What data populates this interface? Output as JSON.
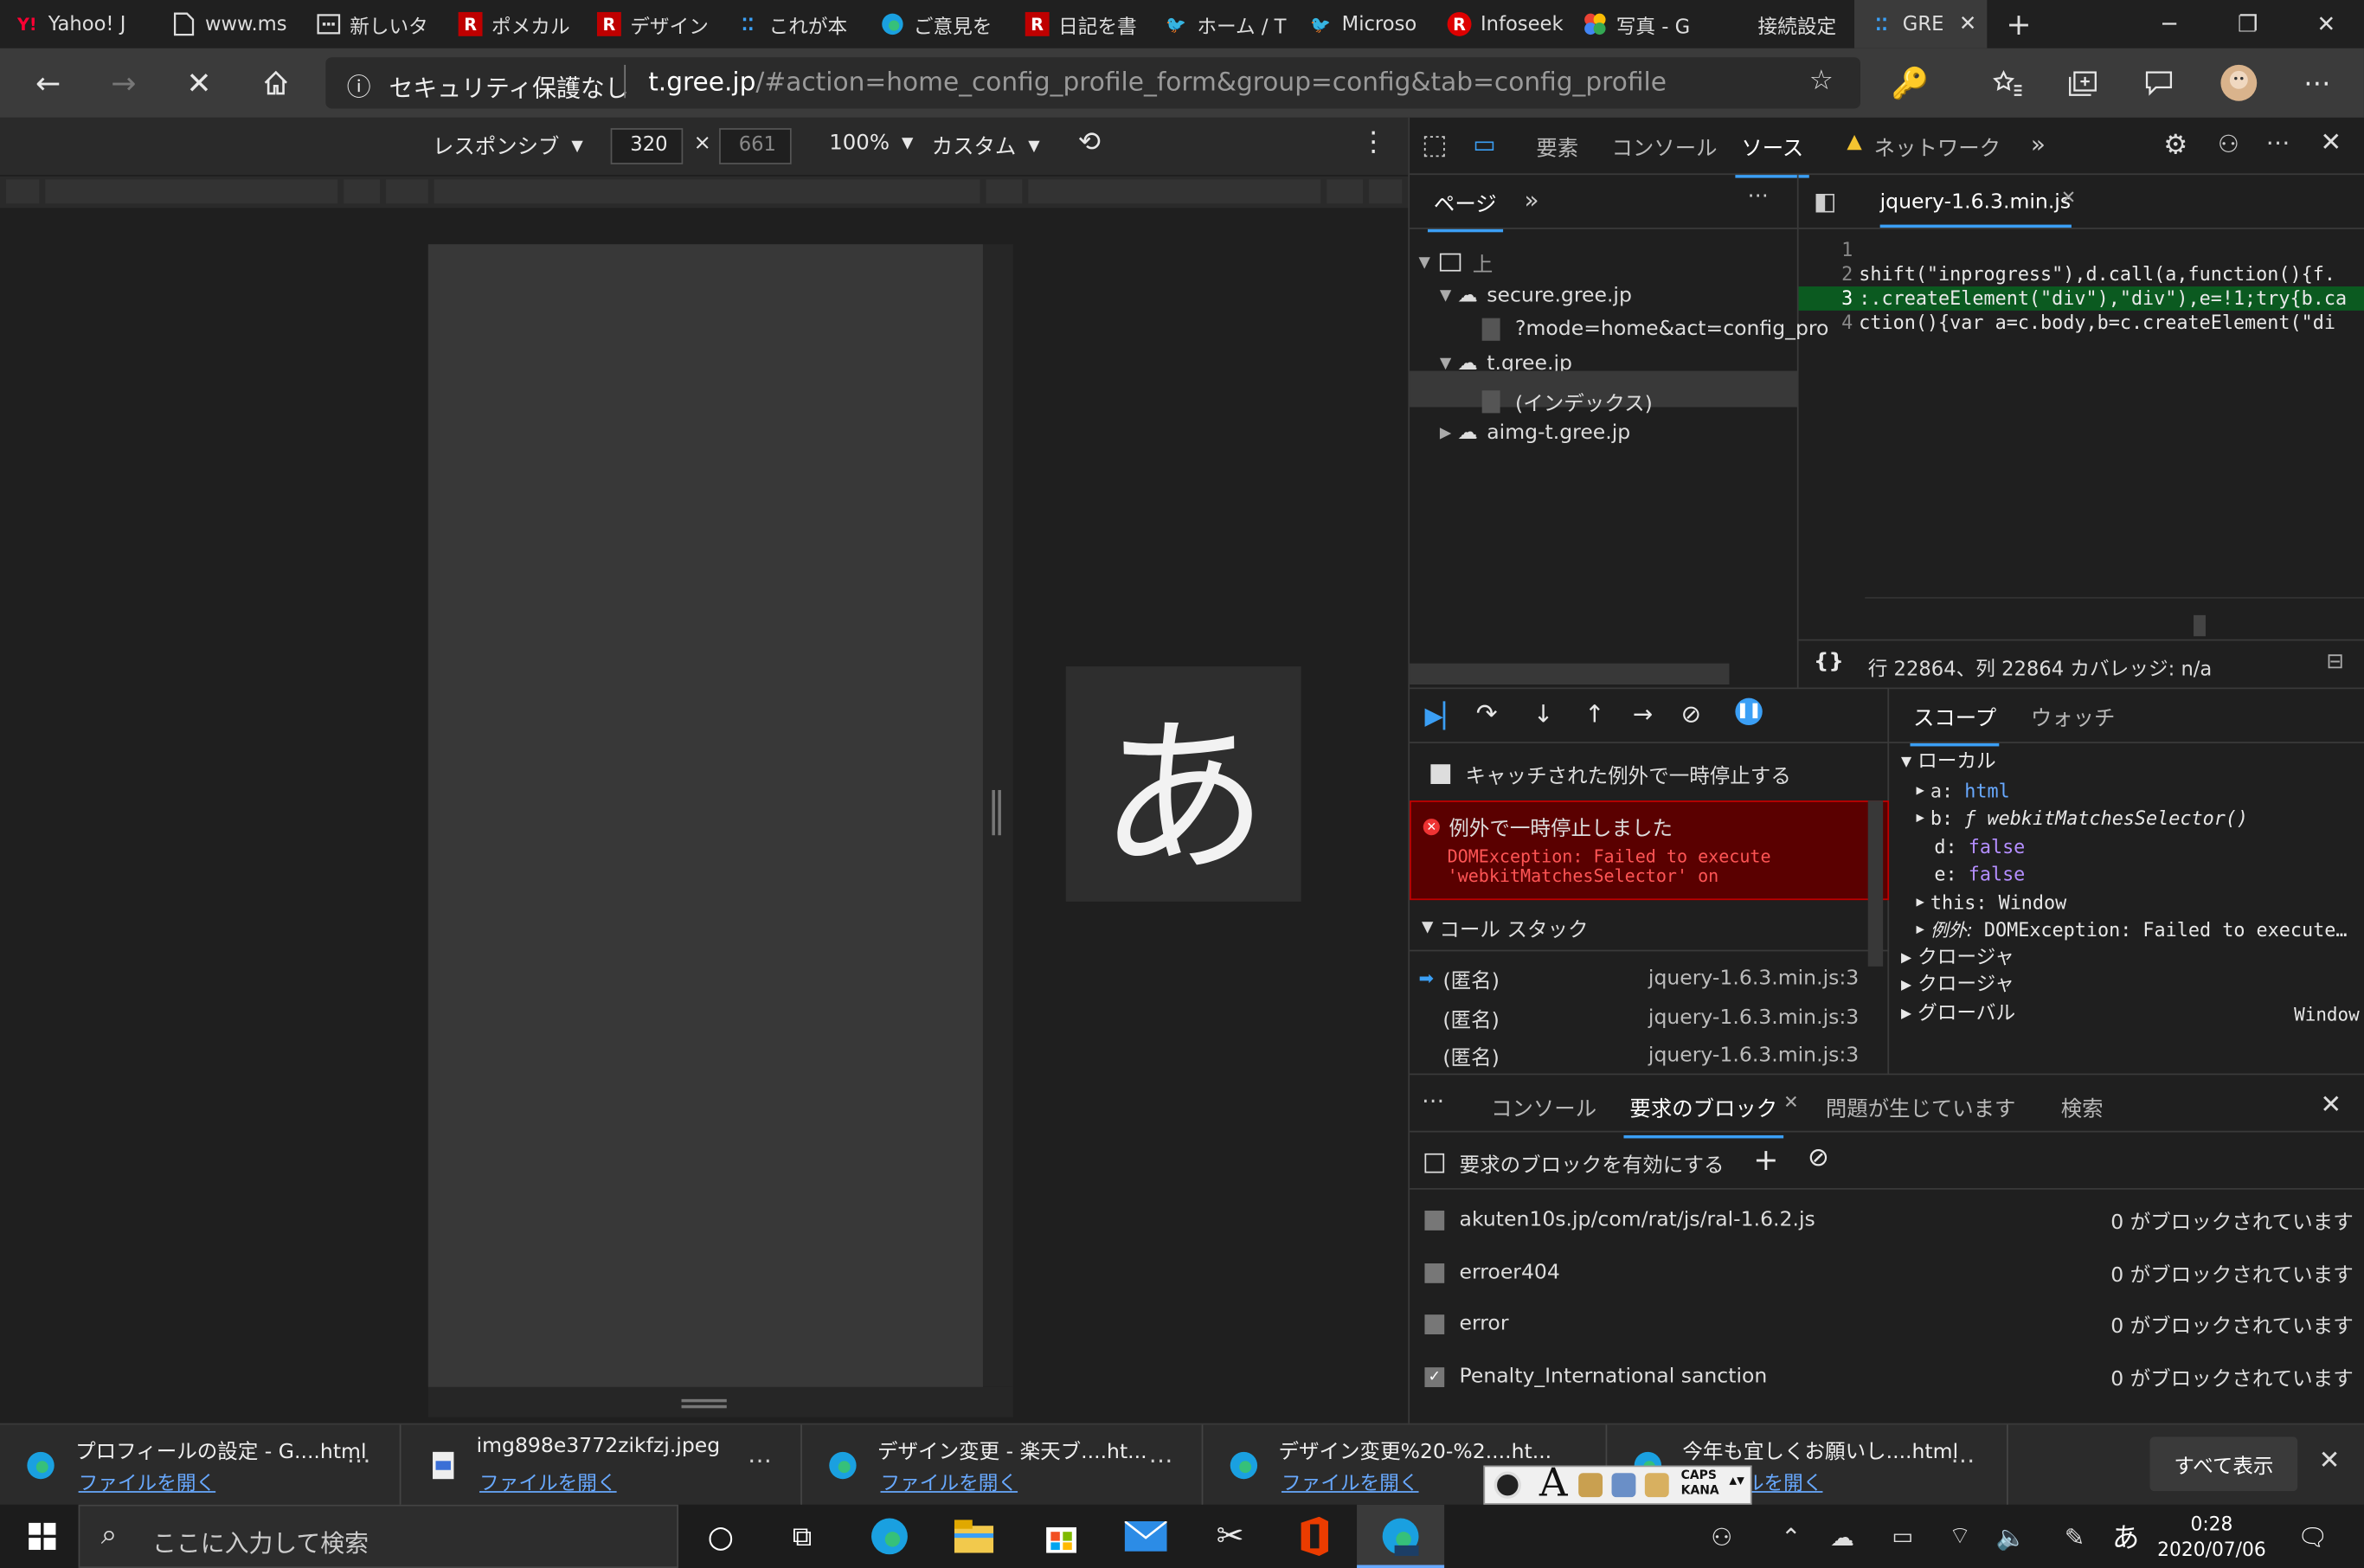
{
  "tabs": [
    {
      "title": "Yahoo! J",
      "icon": "yahoo-icon"
    },
    {
      "title": "www.ms",
      "icon": "page-icon"
    },
    {
      "title": "新しいタ",
      "icon": "newtab-icon"
    },
    {
      "title": "ポメカル",
      "icon": "rakuten-icon"
    },
    {
      "title": "デザイン",
      "icon": "rakuten-icon"
    },
    {
      "title": "これが本",
      "icon": "loading-icon"
    },
    {
      "title": "ご意見を",
      "icon": "edge-icon"
    },
    {
      "title": "日記を書",
      "icon": "rakuten-icon"
    },
    {
      "title": "ホーム / T",
      "icon": "twitter-icon"
    },
    {
      "title": "Microso",
      "icon": "twitter-icon"
    },
    {
      "title": "Infoseek",
      "icon": "infoseek-icon"
    },
    {
      "title": "写真 - G",
      "icon": "google-photos-icon"
    },
    {
      "title": "接続設定",
      "icon": "blank-icon"
    },
    {
      "title": "GRE",
      "icon": "loading-icon"
    }
  ],
  "address": {
    "security": "セキュリティ保護なし",
    "host": "t.gree.jp",
    "path": "/#action=home_config_profile_form&group=config&tab=config_profile"
  },
  "device": {
    "mode": "レスポンシブ",
    "width": "320",
    "height": "661",
    "zoom": "100%",
    "throttle": "カスタム"
  },
  "ime_glyph": "あ",
  "devtools": {
    "tabs": [
      "要素",
      "コンソール",
      "ソース",
      "ネットワーク"
    ],
    "active_tab": "ソース",
    "nav_tab": "ページ",
    "file_tab": "jquery-1.6.3.min.js",
    "tree": [
      {
        "label": "上",
        "depth": 0
      },
      {
        "label": "secure.gree.jp",
        "depth": 1
      },
      {
        "label": "?mode=home&act=config_pro",
        "depth": 2
      },
      {
        "label": "t.gree.jp",
        "depth": 1
      },
      {
        "label": "(インデックス)",
        "depth": 2
      },
      {
        "label": "aimg-t.gree.jp",
        "depth": 1
      }
    ],
    "code_lines": [
      {
        "num": "1",
        "text": ""
      },
      {
        "num": "2",
        "text": "shift(\"inprogress\"),d.call(a,function(){f."
      },
      {
        "num": "3",
        "text": ":.createElement(\"div\"),\"div\"),e=!1;try{b.ca"
      },
      {
        "num": "4",
        "text": "ction(){var a=c.body,b=c.createElement(\"di"
      }
    ],
    "status": "行 22864、列 22864  カバレッジ: n/a",
    "pause_caught": "キャッチされた例外で一時停止する",
    "paused_title": "例外で一時停止しました",
    "paused_msg": "DOMException: Failed to execute 'webkitMatchesSelector' on",
    "callstack_title": "コール スタック",
    "callstack": [
      {
        "fn": "(匿名)",
        "loc": "jquery-1.6.3.min.js:3"
      },
      {
        "fn": "(匿名)",
        "loc": "jquery-1.6.3.min.js:3"
      },
      {
        "fn": "(匿名)",
        "loc": "jquery-1.6.3.min.js:3"
      }
    ],
    "scope_tabs": [
      "スコープ",
      "ウォッチ"
    ],
    "scope": [
      {
        "k": "ローカル",
        "v": "",
        "t": "group"
      },
      {
        "k": "a:",
        "v": "html",
        "t": "blue"
      },
      {
        "k": "b:",
        "v": "ƒ webkitMatchesSelector()",
        "t": "fn"
      },
      {
        "k": "d:",
        "v": "false",
        "t": "purple"
      },
      {
        "k": "e:",
        "v": "false",
        "t": "purple"
      },
      {
        "k": "this:",
        "v": "Window",
        "t": "plain"
      },
      {
        "k": "例外:",
        "v": "DOMException: Failed to execute…",
        "t": "plain"
      },
      {
        "k": "クロージャ",
        "v": "",
        "t": "group"
      },
      {
        "k": "クロージャ",
        "v": "",
        "t": "group"
      },
      {
        "k": "グローバル",
        "v": "Window",
        "t": "group"
      }
    ],
    "drawer_tabs": [
      "コンソール",
      "要求のブロック",
      "問題が生じています",
      "検索"
    ],
    "enable_blocking": "要求のブロックを有効にする",
    "blocked": [
      {
        "pattern": "akuten10s.jp/com/rat/js/ral-1.6.2.js",
        "count": "0 がブロックされています",
        "checked": false
      },
      {
        "pattern": "erroer404",
        "count": "0 がブロックされています",
        "checked": false
      },
      {
        "pattern": "error",
        "count": "0 がブロックされています",
        "checked": false
      },
      {
        "pattern": "Penalty_International sanction",
        "count": "0 がブロックされています",
        "checked": true
      }
    ]
  },
  "downloads": [
    {
      "name": "プロフィールの設定 - G....html",
      "action": "ファイルを開く"
    },
    {
      "name": "img898e3772zikfzj.jpeg",
      "action": "ファイルを開く"
    },
    {
      "name": "デザイン変更 - 楽天ブ....ht...",
      "action": "ファイルを開く"
    },
    {
      "name": "デザイン変更%20-%2....ht...",
      "action": "ファイルを開く"
    },
    {
      "name": "今年も宜しくお願いし....html",
      "action": "ファイルを開く"
    }
  ],
  "show_all": "すべて表示",
  "ime_toolbar": {
    "caps": "CAPS",
    "kana": "KANA"
  },
  "taskbar": {
    "search": "ここに入力して検索",
    "time": "0:28",
    "date": "2020/07/06",
    "ime": "あ"
  },
  "colors": {
    "accent": "#3b9ff5",
    "error_bg": "#5a0000",
    "error_border": "#c00000",
    "highlight": "#0b5a20"
  }
}
